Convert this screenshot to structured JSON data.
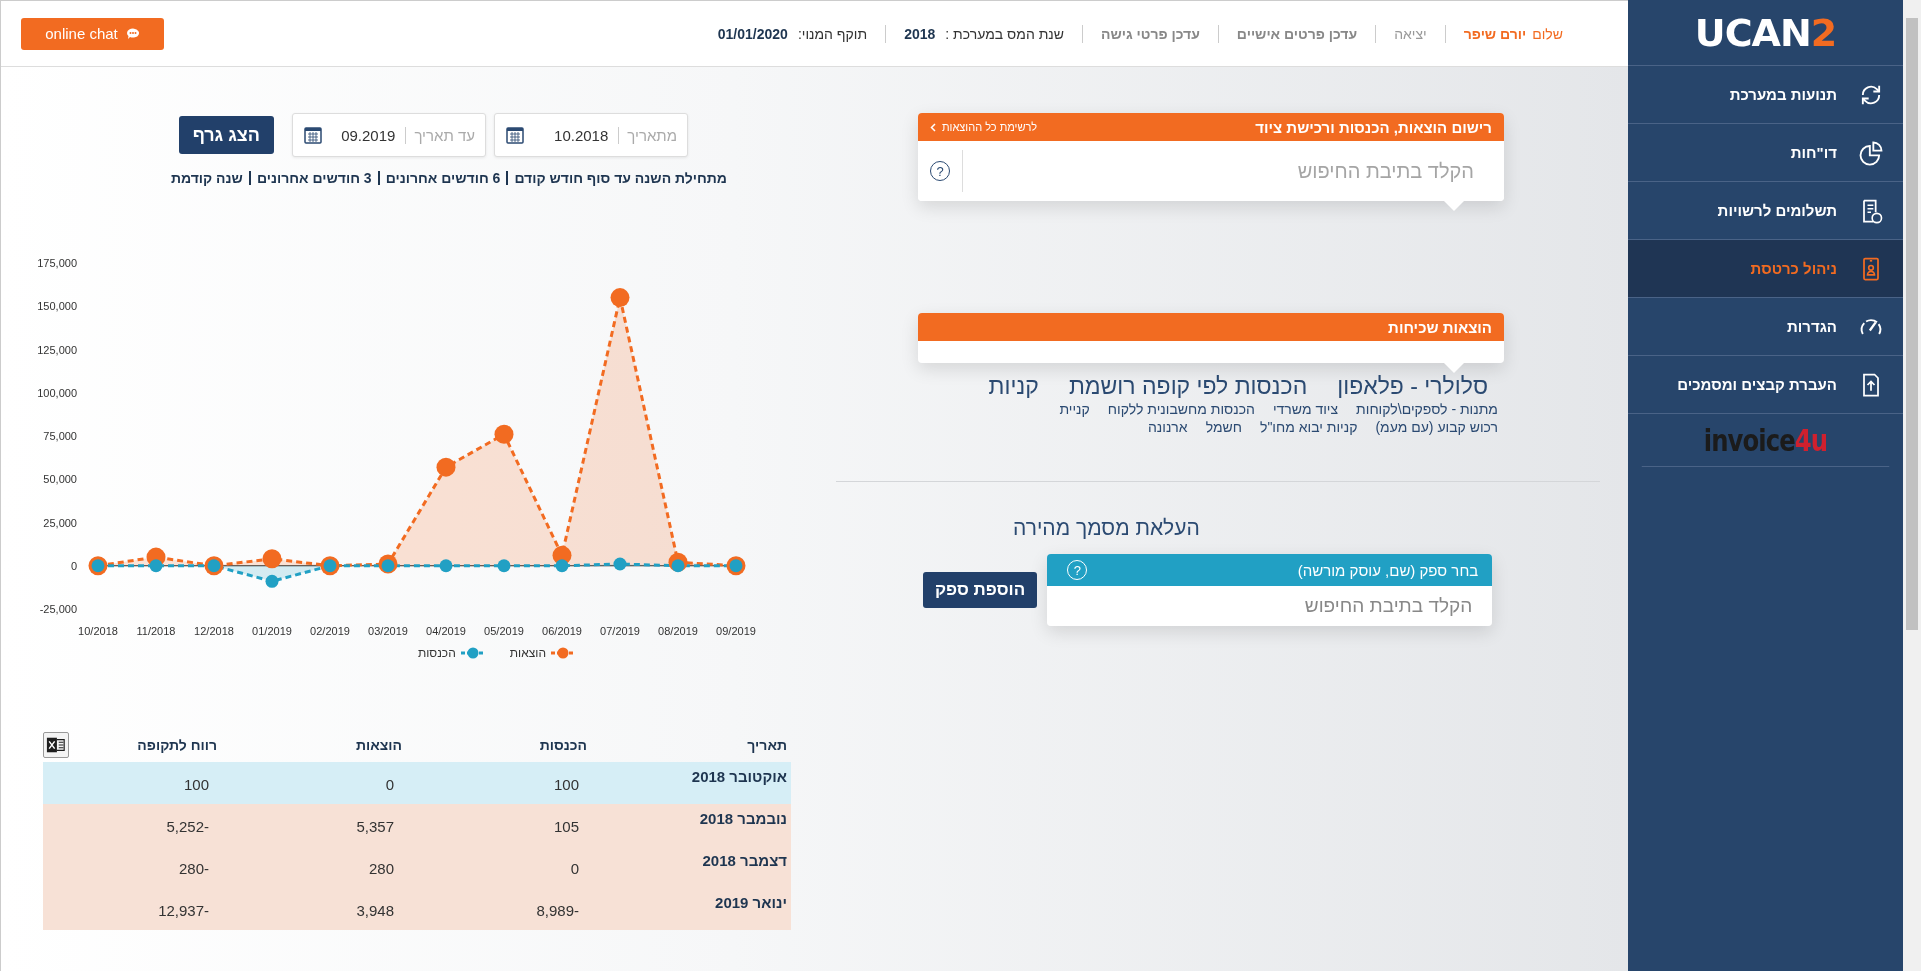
{
  "top_bar": {
    "chat_button": "online chat",
    "greeting": "שלום",
    "user_name": "יורם שיפר",
    "logout": "יציאה",
    "links": [
      "עדכן פרטים אישיים",
      "עדכן פרטי גישה"
    ],
    "tax_year": {
      "label": "שנת המס במערכת :",
      "value": "2018"
    },
    "subscription": {
      "label": "תוקף המנוי:",
      "value": "01/01/2020"
    }
  },
  "sidebar": {
    "logo": {
      "text": "UCAN",
      "accent": "2"
    },
    "items": [
      {
        "label": "תנועות במערכת",
        "selected": false
      },
      {
        "label": "דו\"חות",
        "selected": false
      },
      {
        "label": "תשלומים לרשויות",
        "selected": false
      },
      {
        "label": "ניהול כרטסת",
        "selected": true
      },
      {
        "label": "הגדרות",
        "selected": false
      },
      {
        "label": "העברת קבצים ומסמכים",
        "selected": false
      }
    ],
    "partner_logo": {
      "text": "invoice",
      "accent": "4u"
    }
  },
  "graph_controls": {
    "from": {
      "label": "מתאריך",
      "value": "10.2018"
    },
    "to": {
      "label": "עד תאריך",
      "value": "09.2019"
    },
    "button": "הצג גרף",
    "quick_ranges": [
      "מתחילת השנה עד סוף חודש קודם",
      "6 חודשים אחרונים",
      "3 חודשים אחרונים",
      "שנה קודמת"
    ]
  },
  "chart": {
    "chart_data": {
      "type": "area",
      "categories": [
        "10/2018",
        "11/2018",
        "12/2018",
        "01/2019",
        "02/2019",
        "03/2019",
        "04/2019",
        "05/2019",
        "06/2019",
        "07/2019",
        "08/2019",
        "09/2019"
      ],
      "series": [
        {
          "name": "הוצאות",
          "color": "#f26b21",
          "line_style": "dashed",
          "marker": "circle",
          "values": [
            0,
            5000,
            0,
            4000,
            0,
            1000,
            57000,
            76000,
            6000,
            155000,
            2000,
            0
          ]
        },
        {
          "name": "הכנסות",
          "color": "#21a0c4",
          "line_style": "dashed",
          "marker": "circle",
          "values": [
            0,
            0,
            0,
            -9000,
            0,
            0,
            0,
            0,
            0,
            1000,
            0,
            0
          ]
        }
      ],
      "ylim": [
        -25000,
        175000
      ],
      "yticks": [
        {
          "value": -25000,
          "label": "-25,000"
        },
        {
          "value": 0,
          "label": "0"
        },
        {
          "value": 25000,
          "label": "25,000"
        },
        {
          "value": 50000,
          "label": "50,000"
        },
        {
          "value": 75000,
          "label": "75,000"
        },
        {
          "value": 100000,
          "label": "100,000"
        },
        {
          "value": 125000,
          "label": "125,000"
        },
        {
          "value": 150000,
          "label": "150,000"
        },
        {
          "value": 175000,
          "label": "175,000"
        }
      ]
    }
  },
  "table": {
    "columns": [
      "תאריך",
      "הכנסות",
      "הוצאות",
      "רווח לתקופה"
    ],
    "rows": [
      {
        "color": "#d6eef6",
        "cells": [
          "אוקטובר 2018",
          "100",
          "0",
          "100"
        ]
      },
      {
        "color": "#f7e1d6",
        "cells": [
          "נובמבר 2018",
          "105",
          "5,357",
          "5,252-"
        ]
      },
      {
        "color": "#f7e1d6",
        "cells": [
          "דצמבר 2018",
          "0",
          "280",
          "280-"
        ]
      },
      {
        "color": "#f7e1d6",
        "cells": [
          "ינואר 2019",
          "8,989-",
          "3,948",
          "12,937-"
        ]
      }
    ]
  },
  "expense_entry": {
    "title": "רישום הוצאות, הכנסות ורכישת ציוד",
    "link": "לרשימת כל ההוצאות",
    "placeholder": "הקלד בתיבת החיפוש",
    "help": "?"
  },
  "common_expenses": {
    "title": "הוצאות שכיחות",
    "headings": [
      "סלולרי - פלאפון",
      "הכנסות לפי קופה רושמת",
      "קניות"
    ],
    "items": [
      "מתנות - לספקים\\לקוחות",
      "ציוד משרדי",
      "הכנסות מחשבונית ללקוח",
      "קניית",
      "רכוש קבוע (עם מעמ)",
      "קניות יבוא מחו\"ל",
      "חשמל",
      "ארנונה"
    ]
  },
  "quick_upload": {
    "title": "העלאת מסמך מהירה",
    "supplier": {
      "label": "בחר ספק (שם, עוסק מורשה)",
      "help": "?",
      "placeholder": "הקלד בתיבת החיפוש"
    },
    "add_button": "הוספת ספק"
  }
}
